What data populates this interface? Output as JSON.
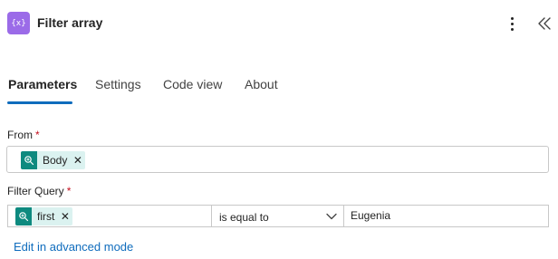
{
  "header": {
    "icon_glyph": "{x}",
    "title": "Filter array",
    "icon_color": "#9b6be8"
  },
  "tabs": [
    {
      "label": "Parameters",
      "active": true
    },
    {
      "label": "Settings",
      "active": false
    },
    {
      "label": "Code view",
      "active": false
    },
    {
      "label": "About",
      "active": false
    }
  ],
  "accent_color": "#0f6cbd",
  "required_marker": "*",
  "from": {
    "label": "From",
    "token": {
      "label": "Body",
      "icon": "dynamic-content-icon",
      "remove_glyph": "✕"
    }
  },
  "filter_query": {
    "label": "Filter Query",
    "left_token": {
      "label": "first",
      "icon": "dynamic-content-icon",
      "remove_glyph": "✕"
    },
    "operator": "is equal to",
    "value": "Eugenia"
  },
  "advanced_link": "Edit in advanced mode"
}
